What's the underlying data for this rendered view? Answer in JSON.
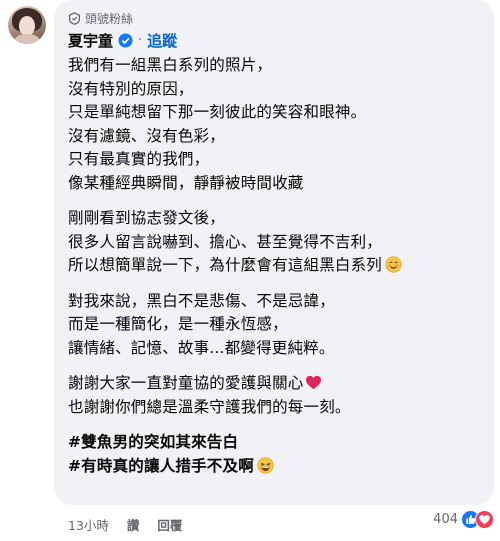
{
  "comment": {
    "badge": "頭號粉絲",
    "author": "夏宇童",
    "follow_label": "追蹤",
    "paragraphs": [
      [
        "我們有一組黑白系列的照片，",
        "沒有特別的原因，",
        "只是單純想留下那一刻彼此的笑容和眼神。",
        "沒有濾鏡、沒有色彩，",
        "只有最真實的我們，",
        "像某種經典瞬間，靜靜被時間收藏"
      ],
      [
        "剛剛看到協志發文後，",
        "很多人留言說嚇到、擔心、甚至覺得不吉利，",
        "所以想簡單說一下，為什麼會有這組黑白系列"
      ],
      [
        "對我來說，黑白不是悲傷、不是忌諱，",
        "而是一種簡化，是一種永恆感，",
        "讓情緒、記憶、故事...都變得更純粹。"
      ],
      [
        "謝謝大家一直對童協的愛護與關心",
        "也謝謝你們總是溫柔守護我們的每一刻。"
      ],
      [
        "#雙魚男的突如其來告白",
        "#有時真的讓人措手不及啊"
      ]
    ]
  },
  "footer": {
    "time": "13小時",
    "like_label": "讚",
    "reply_label": "回覆",
    "reaction_count": "404"
  },
  "icons": {
    "badge": "fan-badge-icon",
    "verified": "verified-check-icon",
    "smile": "smiling-face-emoji",
    "heart": "red-heart-emoji",
    "laugh": "grinning-sweat-emoji",
    "like": "like-reaction-icon",
    "love": "love-reaction-icon"
  },
  "colors": {
    "bubble": "#f0f2f5",
    "link": "#0064d1",
    "verified": "#1877f2",
    "muted": "#65676b",
    "heart": "#e0245e"
  }
}
